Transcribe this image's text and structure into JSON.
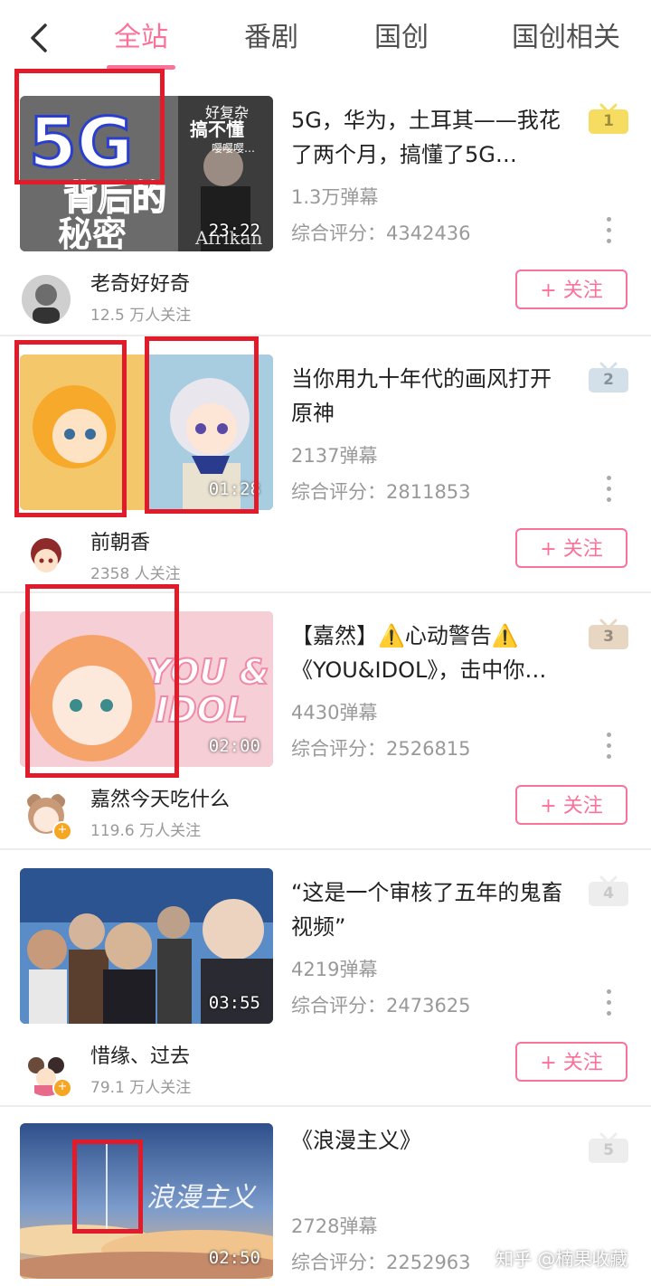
{
  "header": {
    "tabs": [
      {
        "label": "全站",
        "active": true
      },
      {
        "label": "番剧",
        "active": false
      },
      {
        "label": "国创",
        "active": false
      },
      {
        "label": "国创相关",
        "active": false
      }
    ]
  },
  "colors": {
    "accent": "#fb7299",
    "highlight_box": "#e21b2a",
    "rank_gold": "#f7dc62",
    "rank_silver": "#d3e0ea",
    "rank_bronze": "#e6d6c2",
    "rank_default": "#ededed"
  },
  "ranking": [
    {
      "rank": "1",
      "title": "5G，华为，土耳其——我花了两个月，搞懂了5G…",
      "danmaku": "1.3万弹幕",
      "score": "综合评分：4342436",
      "duration": "23:22",
      "uploader": "老奇好好奇",
      "fans": "12.5 万人关注",
      "follow_label": "+ 关注",
      "thumb_text": {
        "big": "5G",
        "line1": "背后的",
        "line2": "秘密",
        "side1": "好复杂",
        "side2": "搞不懂",
        "side3": "嘤嘤嘤…",
        "corner": "Afrikan"
      }
    },
    {
      "rank": "2",
      "title": "当你用九十年代的画风打开原神",
      "danmaku": "2137弹幕",
      "score": "综合评分：2811853",
      "duration": "01:28",
      "uploader": "前朝香",
      "fans": "2358 人关注",
      "follow_label": "+ 关注"
    },
    {
      "rank": "3",
      "title": "【嘉然】⚠️心动警告⚠️《YOU&IDOL》，击中你…",
      "danmaku": "4430弹幕",
      "score": "综合评分：2526815",
      "duration": "02:00",
      "uploader": "嘉然今天吃什么",
      "fans": "119.6 万人关注",
      "follow_label": "+ 关注",
      "thumb_text": {
        "line1": "YOU &",
        "line2": "IDOL"
      }
    },
    {
      "rank": "4",
      "title": "“这是一个审核了五年的鬼畜视频”",
      "danmaku": "4219弹幕",
      "score": "综合评分：2473625",
      "duration": "03:55",
      "uploader": "惜缘、过去",
      "fans": "79.1 万人关注",
      "follow_label": "+ 关注"
    },
    {
      "rank": "5",
      "title": "《浪漫主义》",
      "danmaku": "2728弹幕",
      "score": "综合评分：2252963",
      "duration": "02:50",
      "thumb_text": {
        "art": "浪漫主义"
      }
    }
  ],
  "watermark": "知乎 @楠果收藏",
  "icons": {
    "back": "chevron-left-icon",
    "more": "more-vertical-icon",
    "rank": "tv-rank-icon"
  }
}
